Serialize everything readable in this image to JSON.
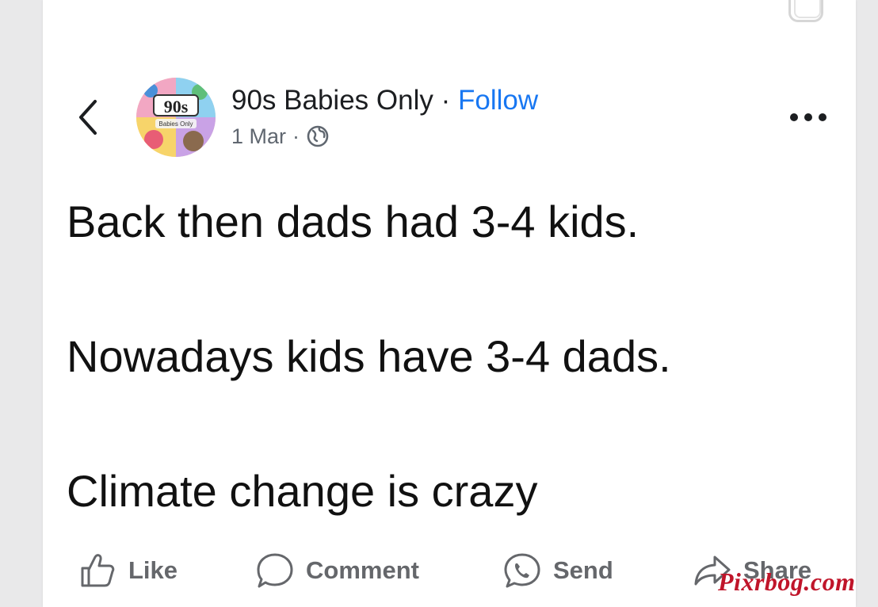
{
  "post": {
    "page_name": "90s Babies Only",
    "separator": " · ",
    "follow_label": "Follow",
    "date": "1 Mar",
    "meta_separator": "·",
    "privacy_icon": "globe-icon",
    "avatar": {
      "logo_text": "90s",
      "logo_subtext": "Babies Only"
    },
    "lines": [
      "Back then dads had 3-4 kids.",
      "Nowadays kids have 3-4 dads.",
      "Climate change is crazy"
    ]
  },
  "actions": {
    "like": {
      "label": "Like",
      "icon": "thumbs-up-icon"
    },
    "comment": {
      "label": "Comment",
      "icon": "comment-bubble-icon"
    },
    "send": {
      "label": "Send",
      "icon": "messenger-icon"
    },
    "share": {
      "label": "Share",
      "icon": "share-arrow-icon"
    }
  },
  "watermark": "Pixrbog.com",
  "colors": {
    "accent": "#1877f2",
    "text": "#111111",
    "muted": "#65676b",
    "watermark": "#c0152a"
  }
}
